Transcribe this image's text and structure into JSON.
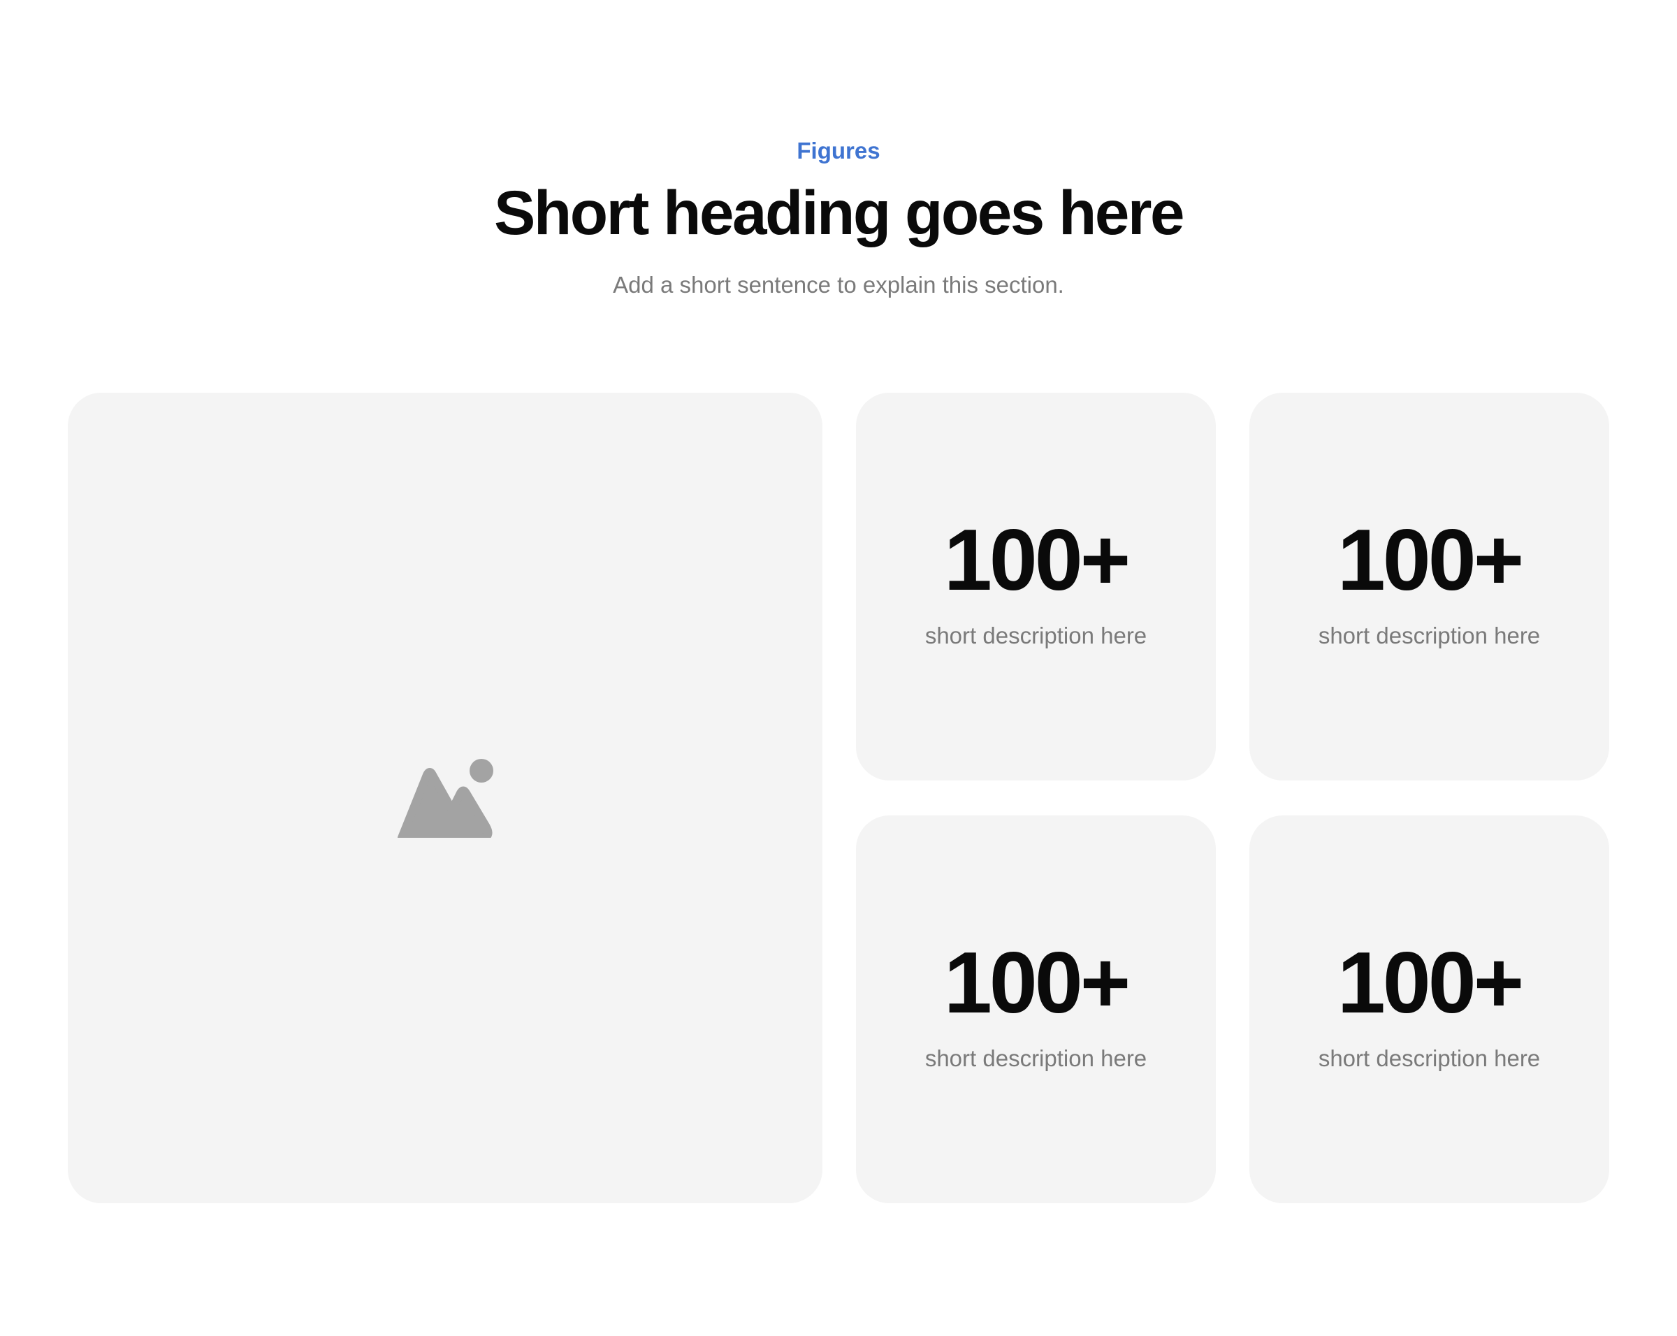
{
  "header": {
    "eyebrow": "Figures",
    "title": "Short heading goes here",
    "subtitle": "Add a short sentence to explain this section."
  },
  "media": {
    "icon": "image-placeholder-icon"
  },
  "stats": [
    {
      "value": "100+",
      "label": "short description here"
    },
    {
      "value": "100+",
      "label": "short description here"
    },
    {
      "value": "100+",
      "label": "short description here"
    },
    {
      "value": "100+",
      "label": "short description here"
    }
  ],
  "colors": {
    "accent": "#3f74d1",
    "card_background": "#f4f4f4",
    "muted_text": "#7a7a7a",
    "icon": "#a3a3a3"
  }
}
